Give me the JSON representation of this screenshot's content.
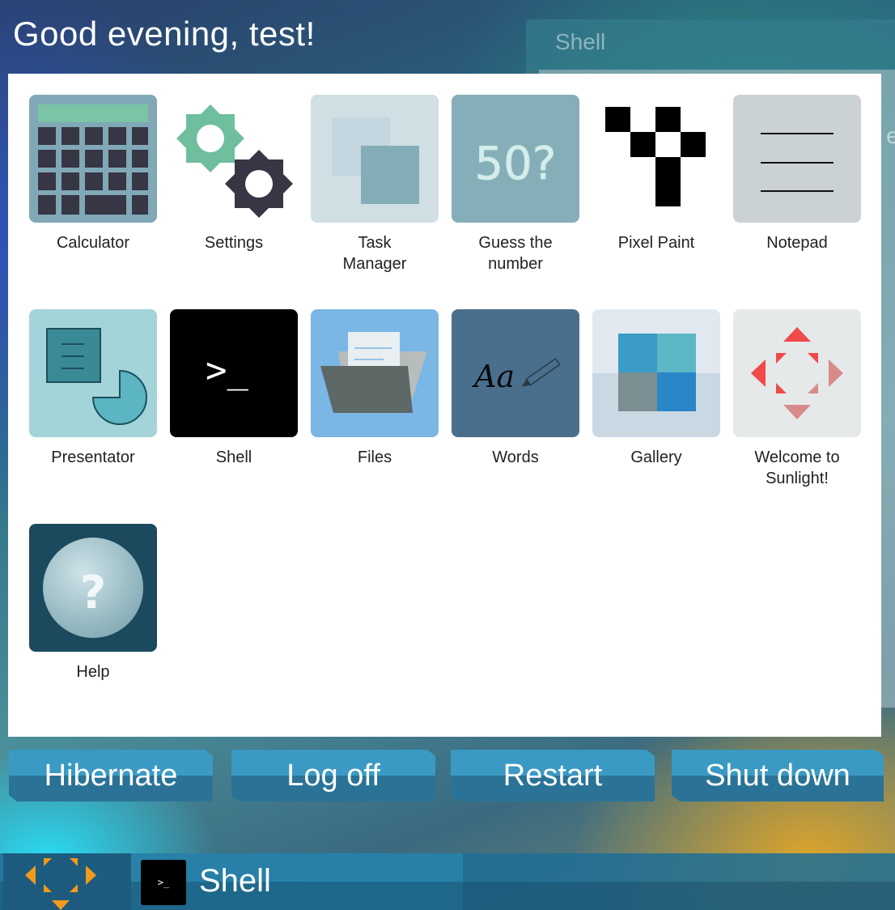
{
  "greeting": "Good evening, test!",
  "background_window": {
    "title": "Shell",
    "peek_text": "er"
  },
  "apps": [
    {
      "label": "Calculator",
      "icon": "calculator-icon"
    },
    {
      "label": "Settings",
      "icon": "gears-icon"
    },
    {
      "label": "Task\nManager",
      "icon": "task-manager-icon"
    },
    {
      "label": "Guess the\nnumber",
      "icon": "guess-number-icon",
      "tile_text": "50?"
    },
    {
      "label": "Pixel Paint",
      "icon": "pixel-paint-icon"
    },
    {
      "label": "Notepad",
      "icon": "notepad-icon"
    },
    {
      "label": "Presentator",
      "icon": "presentator-icon"
    },
    {
      "label": "Shell",
      "icon": "terminal-icon",
      "tile_text": ">_"
    },
    {
      "label": "Files",
      "icon": "folder-icon"
    },
    {
      "label": "Words",
      "icon": "words-icon",
      "tile_text": "Aa"
    },
    {
      "label": "Gallery",
      "icon": "gallery-icon"
    },
    {
      "label": "Welcome to\nSunlight!",
      "icon": "sunlight-logo-icon"
    },
    {
      "label": "Help",
      "icon": "help-icon",
      "tile_text": "?"
    }
  ],
  "power": {
    "hibernate": "Hibernate",
    "logoff": "Log off",
    "restart": "Restart",
    "shutdown": "Shut down"
  },
  "taskbar": {
    "start_icon": "sunlight-start-icon",
    "items": [
      {
        "label": "Shell",
        "icon_text": ">_"
      }
    ]
  },
  "colors": {
    "button_top": "#3a9ac3",
    "button_bottom": "#2b7396",
    "panel": "#ffffff"
  }
}
